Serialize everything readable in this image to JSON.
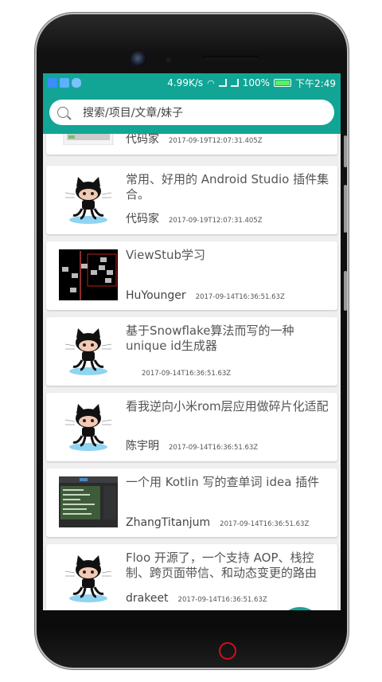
{
  "statusbar": {
    "speed": "4.99K/s",
    "battery": "100%",
    "time": "下午2:49",
    "icons": [
      "shield-app-icon",
      "doc-app-icon",
      "cloud-app-icon",
      "wifi-icon",
      "signal-icon",
      "battery-icon"
    ]
  },
  "search": {
    "placeholder": "搜索/项目/文章/妹子"
  },
  "articles": [
    {
      "title": "",
      "author": "代码家",
      "date": "2017-09-19T12:07:31.405Z",
      "thumb": "screenshot"
    },
    {
      "title": "常用、好用的 Android Studio 插件集合。",
      "author": "代码家",
      "date": "2017-09-19T12:07:31.405Z",
      "thumb": "octocat"
    },
    {
      "title": "ViewStub学习",
      "author": "HuYounger",
      "date": "2017-09-14T16:36:51.63Z",
      "thumb": "viewtree"
    },
    {
      "title": "基于Snowflake算法而写的一种unique id生成器",
      "author": "",
      "date": "2017-09-14T16:36:51.63Z",
      "thumb": "octocat"
    },
    {
      "title": "看我逆向小米rom层应用做碎片化适配",
      "author": "陈宇明",
      "date": "2017-09-14T16:36:51.63Z",
      "thumb": "octocat"
    },
    {
      "title": "一个用 Kotlin 写的查单词 idea 插件",
      "author": "ZhangTitanjum",
      "date": "2017-09-14T16:36:51.63Z",
      "thumb": "ide"
    },
    {
      "title": "Floo 开源了，一个支持 AOP、栈控制、跨页面带信、和动态变更的路由",
      "author": "drakeet",
      "date": "2017-09-14T16:36:51.63Z",
      "thumb": "octocat"
    }
  ],
  "fab": {
    "icon": "menu-icon"
  },
  "colors": {
    "accent": "#12a595",
    "home_button": "#d10e1e"
  }
}
